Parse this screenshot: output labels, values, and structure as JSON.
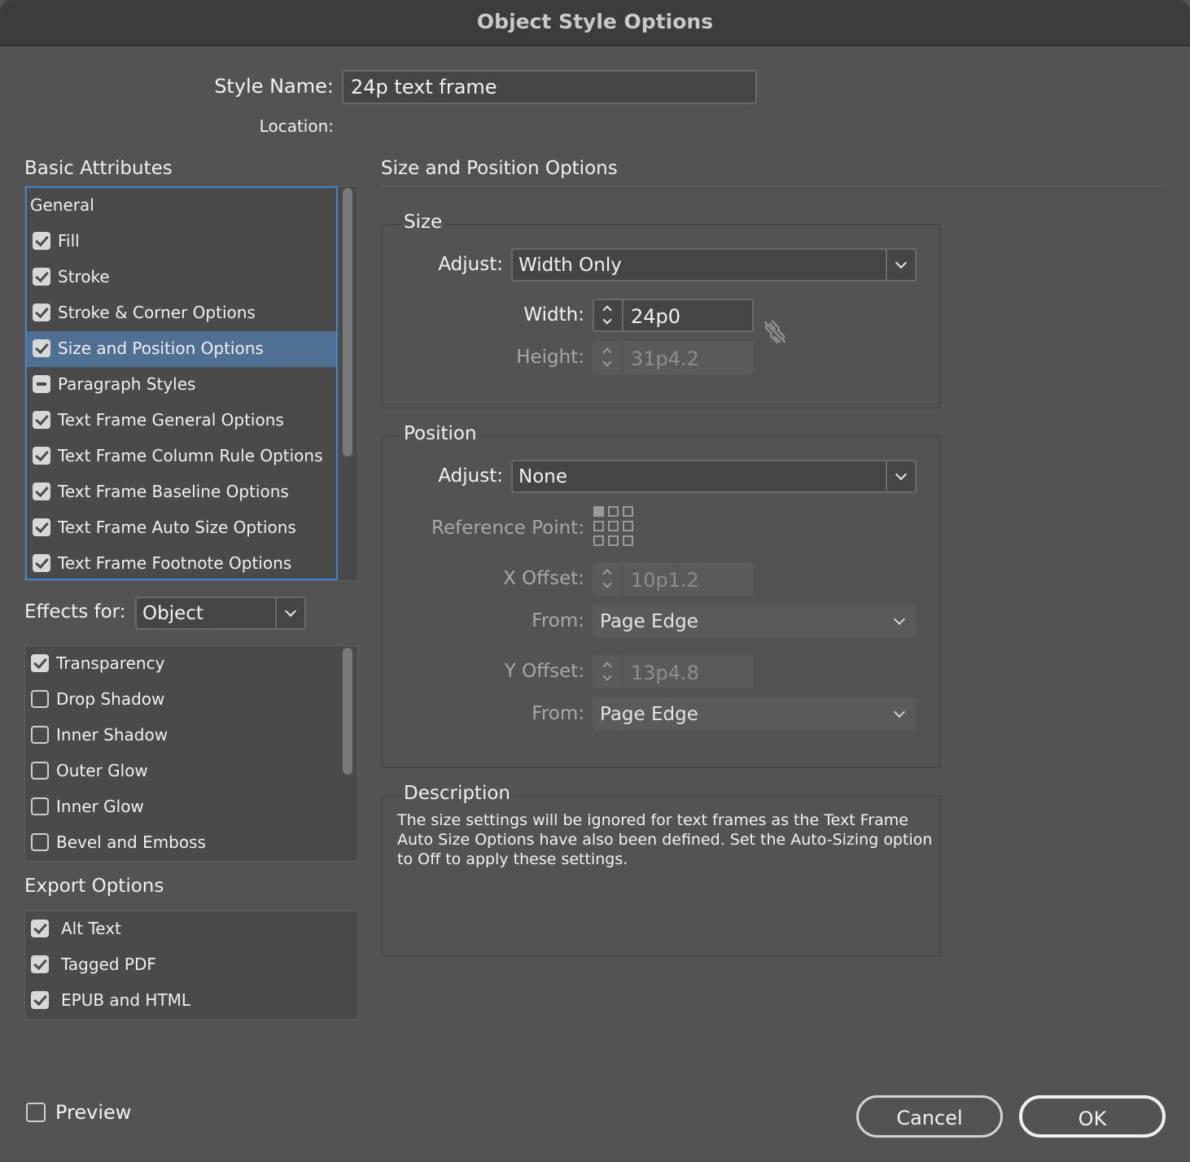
{
  "window": {
    "title": "Object Style Options"
  },
  "style_name": {
    "label": "Style Name:",
    "value": "24p text frame"
  },
  "location": {
    "label": "Location:"
  },
  "basic_attributes": {
    "title": "Basic Attributes",
    "items": [
      {
        "label": "General",
        "state": "none"
      },
      {
        "label": "Fill",
        "state": "checked"
      },
      {
        "label": "Stroke",
        "state": "checked"
      },
      {
        "label": "Stroke & Corner Options",
        "state": "checked"
      },
      {
        "label": "Size and Position Options",
        "state": "checked",
        "selected": true
      },
      {
        "label": "Paragraph Styles",
        "state": "mixed"
      },
      {
        "label": "Text Frame General Options",
        "state": "checked"
      },
      {
        "label": "Text Frame Column Rule Options",
        "state": "checked"
      },
      {
        "label": "Text Frame Baseline Options",
        "state": "checked"
      },
      {
        "label": "Text Frame Auto Size Options",
        "state": "checked"
      },
      {
        "label": "Text Frame Footnote Options",
        "state": "checked"
      }
    ]
  },
  "effects": {
    "label": "Effects for:",
    "selected": "Object",
    "items": [
      {
        "label": "Transparency",
        "state": "checked"
      },
      {
        "label": "Drop Shadow",
        "state": "unchecked"
      },
      {
        "label": "Inner Shadow",
        "state": "unchecked"
      },
      {
        "label": "Outer Glow",
        "state": "unchecked"
      },
      {
        "label": "Inner Glow",
        "state": "unchecked"
      },
      {
        "label": "Bevel and Emboss",
        "state": "unchecked"
      }
    ]
  },
  "export_options": {
    "title": "Export Options",
    "items": [
      {
        "label": "Alt Text",
        "state": "checked"
      },
      {
        "label": "Tagged PDF",
        "state": "checked"
      },
      {
        "label": "EPUB and HTML",
        "state": "checked"
      }
    ]
  },
  "panel": {
    "title": "Size and Position Options",
    "size": {
      "title": "Size",
      "adjust_label": "Adjust:",
      "adjust_value": "Width Only",
      "width_label": "Width:",
      "width_value": "24p0",
      "height_label": "Height:",
      "height_value": "31p4.2"
    },
    "position": {
      "title": "Position",
      "adjust_label": "Adjust:",
      "adjust_value": "None",
      "reference_label": "Reference Point:",
      "x_offset_label": "X Offset:",
      "x_offset_value": "10p1.2",
      "x_from_label": "From:",
      "x_from_value": "Page Edge",
      "y_offset_label": "Y Offset:",
      "y_offset_value": "13p4.8",
      "y_from_label": "From:",
      "y_from_value": "Page Edge"
    },
    "description": {
      "title": "Description",
      "text": "The size settings will be ignored for text frames as the Text Frame Auto Size Options have also been defined. Set the Auto-Sizing option to Off to apply these settings."
    }
  },
  "footer": {
    "preview_label": "Preview",
    "cancel_label": "Cancel",
    "ok_label": "OK"
  },
  "colors": {
    "background": "#535353",
    "selection": "#4f6f93",
    "focus_ring": "#3d84c8"
  }
}
